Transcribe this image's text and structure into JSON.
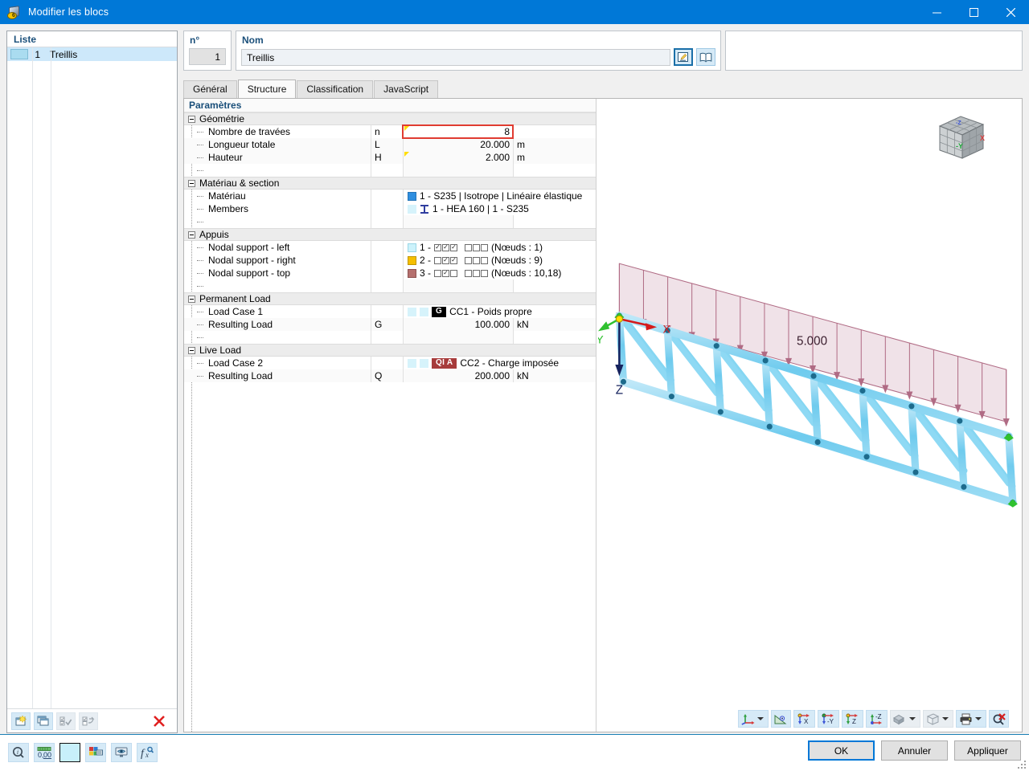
{
  "window": {
    "title": "Modifier les blocs",
    "icon": "block-cube-icon",
    "minimize_label": "–",
    "maximize_label": "□",
    "close_label": "✕"
  },
  "liste": {
    "header": "Liste",
    "rows": [
      {
        "num": "1",
        "name": "Treillis"
      }
    ],
    "toolbar": [
      {
        "name": "new-block-button",
        "label": "Nouveau"
      },
      {
        "name": "copy-block-button",
        "label": "Copier"
      },
      {
        "name": "check-all-button",
        "label": "Tout sélectionner"
      },
      {
        "name": "invert-selection-button",
        "label": "Inverser"
      },
      {
        "name": "delete-block-button",
        "label": "Supprimer"
      }
    ]
  },
  "identity": {
    "number_label": "n°",
    "number_value": "1",
    "name_label": "Nom",
    "name_value": "Treillis",
    "edit_button": "edit-icon",
    "library_button": "library-icon"
  },
  "tabs": [
    {
      "label": "Général",
      "active": false
    },
    {
      "label": "Structure",
      "active": true
    },
    {
      "label": "Classification",
      "active": false
    },
    {
      "label": "JavaScript",
      "active": false
    }
  ],
  "parameters": {
    "header": "Paramètres",
    "groups": [
      {
        "title": "Géométrie",
        "rows": [
          {
            "label": "Nombre de travées",
            "symbol": "n",
            "value": "8",
            "unit": "",
            "editing": true,
            "marker": true
          },
          {
            "label": "Longueur totale",
            "symbol": "L",
            "value": "20.000",
            "unit": "m",
            "editing": false,
            "marker": false
          },
          {
            "label": "Hauteur",
            "symbol": "H",
            "value": "2.000",
            "unit": "m",
            "editing": false,
            "marker": true
          }
        ]
      },
      {
        "title": "Matériau & section",
        "rows": [
          {
            "label": "Matériau",
            "symbol": "",
            "text": "1 - S235 | Isotrope | Linéaire élastique",
            "swatch": "#2f8fe0",
            "kind": "material"
          },
          {
            "label": "Members",
            "symbol": "",
            "text": "1 - HEA 160 | 1 - S235",
            "swatch": "#d6f3fb",
            "kind": "section"
          }
        ]
      },
      {
        "title": "Appuis",
        "rows": [
          {
            "label": "Nodal support - left",
            "symbol": "",
            "prefix": "1 -",
            "swatch": "#ccf2fb",
            "checks1": [
              true,
              true,
              true
            ],
            "checks2": [
              false,
              false,
              false
            ],
            "suffix": "(Nœuds : 1)",
            "kind": "support"
          },
          {
            "label": "Nodal support - right",
            "symbol": "",
            "prefix": "2 -",
            "swatch": "#f5bf00",
            "checks1": [
              false,
              true,
              true
            ],
            "checks2": [
              false,
              false,
              false
            ],
            "suffix": "(Nœuds : 9)",
            "kind": "support"
          },
          {
            "label": "Nodal support - top",
            "symbol": "",
            "prefix": "3 -",
            "swatch": "#b5706e",
            "checks1": [
              false,
              true,
              false
            ],
            "checks2": [
              false,
              false,
              false
            ],
            "suffix": "(Nœuds : 10,18)",
            "kind": "support"
          }
        ]
      },
      {
        "title": "Permanent Load",
        "rows": [
          {
            "label": "Load Case 1",
            "symbol": "",
            "badge": "G",
            "badge_kind": "g",
            "text": "CC1 - Poids propre",
            "kind": "loadcase"
          },
          {
            "label": "Resulting Load",
            "symbol": "G",
            "value": "100.000",
            "unit": "kN",
            "editing": false,
            "marker": false
          }
        ]
      },
      {
        "title": "Live Load",
        "rows": [
          {
            "label": "Load Case 2",
            "symbol": "",
            "badge": "QI A",
            "badge_kind": "q",
            "text": "CC2 - Charge imposée",
            "kind": "loadcase"
          },
          {
            "label": "Resulting Load",
            "symbol": "Q",
            "value": "200.000",
            "unit": "kN",
            "editing": false,
            "marker": false
          }
        ]
      }
    ]
  },
  "viewport": {
    "load_label": "5.000",
    "axis_x": "X",
    "axis_y": "Y",
    "axis_z": "Z",
    "navcube": {
      "face_y": "-Y",
      "face_x": "X"
    },
    "toolbar": [
      {
        "name": "coordinate-system-button",
        "caret": true
      },
      {
        "name": "measure-button",
        "caret": false
      },
      {
        "name": "view-x-button",
        "caret": false
      },
      {
        "name": "view-y-button",
        "caret": false
      },
      {
        "name": "view-z-button",
        "caret": false
      },
      {
        "name": "view-isometric-button",
        "caret": false
      },
      {
        "name": "render-mode-button",
        "caret": true
      },
      {
        "name": "wireframe-button",
        "caret": true
      },
      {
        "name": "print-button",
        "caret": true
      },
      {
        "name": "clear-zoom-button",
        "caret": false
      }
    ]
  },
  "bottom_toolbar": [
    {
      "name": "info-button",
      "label": "Info"
    },
    {
      "name": "decimals-button",
      "label": "Décimales"
    },
    {
      "name": "color-swatch-button",
      "label": "Couleur"
    },
    {
      "name": "display-properties-button",
      "label": "Propriétés d'affichage"
    },
    {
      "name": "view-settings-button",
      "label": "Paramètres de vue"
    },
    {
      "name": "formula-button",
      "label": "Formule"
    }
  ],
  "dialog_buttons": {
    "ok": "OK",
    "cancel": "Annuler",
    "apply": "Appliquer"
  },
  "colors": {
    "accent": "#0078d7",
    "title_bar": "#0078d7",
    "label_blue": "#1a4f7a",
    "edit_highlight": "#e03c31",
    "marker_yellow": "#ffdd00",
    "member_blue": "#7fd4f2",
    "load_pink": "#b06b84",
    "load_fill": "#f0e2e8"
  }
}
